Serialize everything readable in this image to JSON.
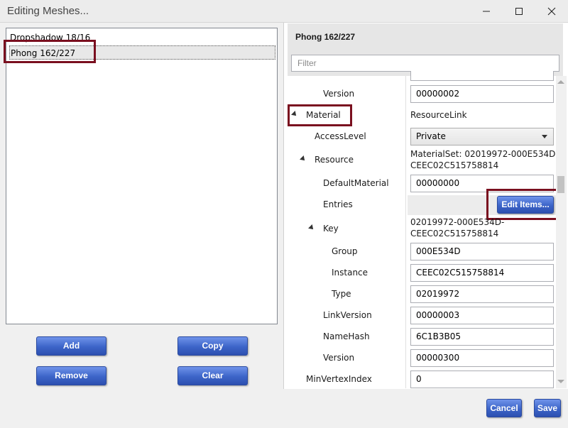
{
  "window": {
    "title": "Editing Meshes...",
    "controls": [
      "minimize",
      "maximize",
      "close"
    ]
  },
  "left_list": {
    "items": [
      {
        "label": "Dropshadow 18/16",
        "selected": false
      },
      {
        "label": "Phong 162/227",
        "selected": true
      }
    ]
  },
  "left_buttons": {
    "add": "Add",
    "copy": "Copy",
    "remove": "Remove",
    "clear": "Clear"
  },
  "right_panel": {
    "title": "Phong 162/227",
    "filter_placeholder": "Filter",
    "properties": [
      {
        "label": "Version",
        "value": "00000002"
      },
      {
        "label": "Material",
        "value": "ResourceLink",
        "expanded": true
      },
      {
        "label": "AccessLevel",
        "value": "Private",
        "type": "combo"
      },
      {
        "label": "Resource",
        "value_line1": "MaterialSet: 02019972-000E534D-",
        "value_line2": "CEEC02C515758814",
        "expanded": true
      },
      {
        "label": "DefaultMaterial",
        "value": "00000000"
      },
      {
        "label": "Entries",
        "button": "Edit Items..."
      },
      {
        "label": "Key",
        "value_line1": "02019972-000E534D-",
        "value_line2": "CEEC02C515758814",
        "expanded": true
      },
      {
        "label": "Group",
        "value": "000E534D"
      },
      {
        "label": "Instance",
        "value": "CEEC02C515758814"
      },
      {
        "label": "Type",
        "value": "02019972"
      },
      {
        "label": "LinkVersion",
        "value": "00000003"
      },
      {
        "label": "NameHash",
        "value": "6C1B3B05"
      },
      {
        "label": "Version",
        "value": "00000300"
      },
      {
        "label": "MinVertexIndex",
        "value": "0"
      }
    ]
  },
  "dialog_buttons": {
    "cancel": "Cancel",
    "save": "Save"
  },
  "colors": {
    "accent_button": "#3c64c8",
    "highlight_box": "#7a0f1f"
  }
}
